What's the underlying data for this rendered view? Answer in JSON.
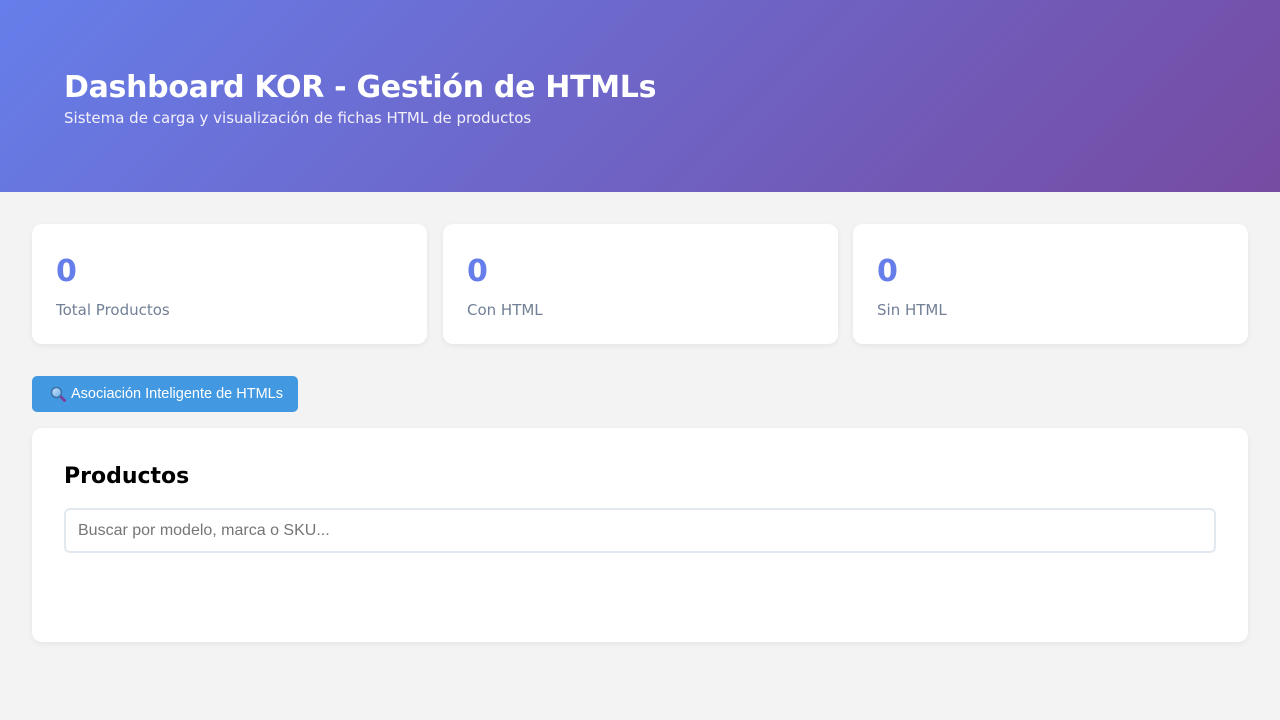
{
  "header": {
    "title": "Dashboard KOR - Gestión de HTMLs",
    "subtitle": "Sistema de carga y visualización de fichas HTML de productos"
  },
  "stats": [
    {
      "value": "0",
      "label": "Total Productos"
    },
    {
      "value": "0",
      "label": "Con HTML"
    },
    {
      "value": "0",
      "label": "Sin HTML"
    }
  ],
  "actions": {
    "association_button_label": "Asociación Inteligente de HTMLs",
    "association_button_icon": "magnifier-icon"
  },
  "products": {
    "title": "Productos",
    "search_placeholder": "Buscar por modelo, marca o SKU...",
    "search_value": ""
  },
  "colors": {
    "header_gradient_start": "#667eea",
    "header_gradient_end": "#764ba2",
    "stat_value": "#667eea",
    "button": "#4299e1"
  }
}
